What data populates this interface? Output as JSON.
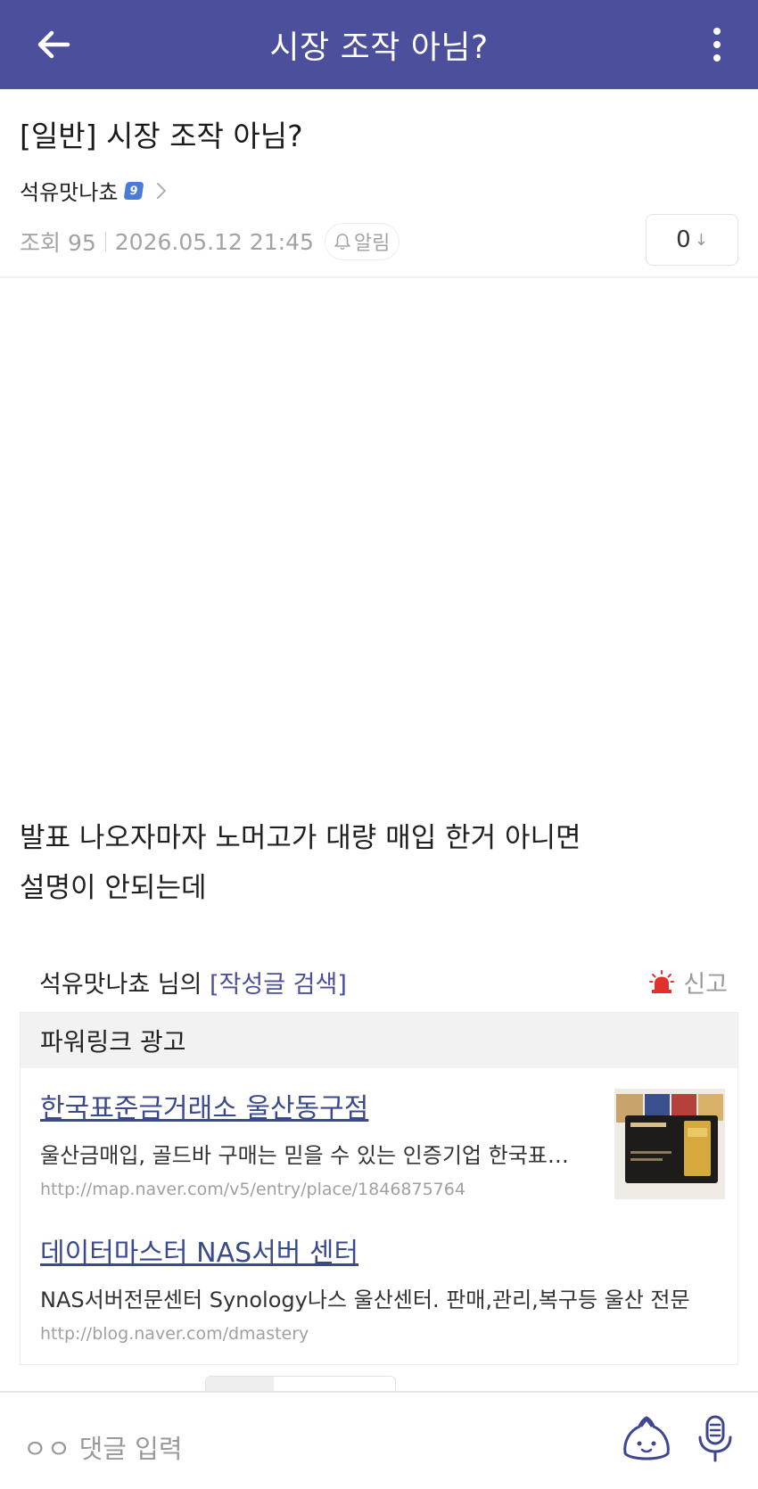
{
  "appbar": {
    "title": "시장 조작 아님?",
    "back_icon": "arrow-left-icon",
    "more_icon": "vertical-dots-icon",
    "color": "#4b4f9c"
  },
  "post": {
    "title": "[일반] 시장 조작 아님?",
    "author": "석유맛나쵸",
    "level_badge": "9",
    "views_label": "조회 95",
    "datetime": "2026.05.12 21:45",
    "notify_label": "알림",
    "vote_count": "0",
    "vote_arrow": "↓",
    "body_lines": [
      "발표 나오자마자 노머고가 대량 매입 한거 아니면",
      "설명이 안되는데"
    ]
  },
  "author_search": {
    "prefix": "석유맛나쵸 님의 ",
    "link": "[작성글 검색]",
    "report_label": "신고",
    "report_icon": "siren-icon"
  },
  "ads": {
    "header": "파워링크 광고",
    "items": [
      {
        "title": "한국표준금거래소 울산동구점",
        "desc": "울산금매입, 골드바 구매는 믿을 수 있는 인증기업 한국표준금거래소",
        "url": "http://map.naver.com/v5/entry/place/1846875764"
      },
      {
        "title": "데이터마스터 NAS서버 센터",
        "desc": "NAS서버전문센터 Synology나스 울산센터. 판매,관리,복구등 울산 전문",
        "url": "http://blog.naver.com/dmastery"
      }
    ]
  },
  "comment_bar": {
    "placeholder": "ㅇㅇ 댓글 입력",
    "emoji_icon": "dumpling-emoji-icon",
    "mic_icon": "microphone-icon"
  }
}
